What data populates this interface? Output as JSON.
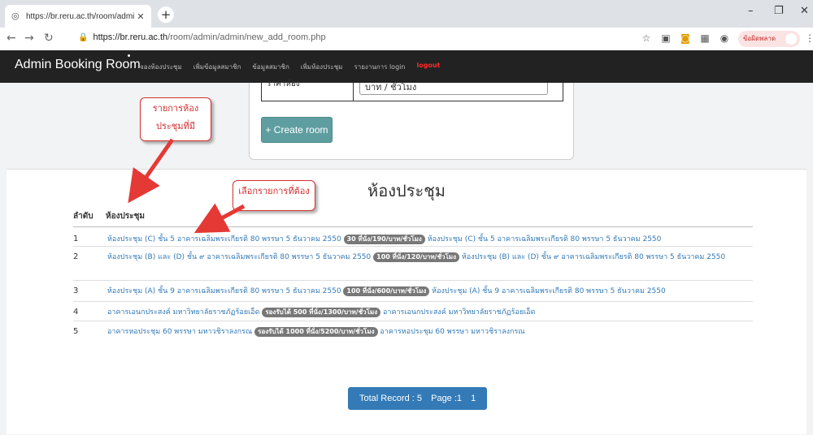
{
  "browser": {
    "tab_title": "https://br.reru.ac.th/room/admin",
    "url_host": "https://br.reru.ac.th",
    "url_path": "/room/admin/admin/new_add_room.php",
    "profile_label": "ข้อผิดพลาด"
  },
  "navbar": {
    "brand": "Admin Booking Room",
    "links": [
      "จองห้องประชุม",
      "เพิ่มข้อมูลสมาชิก",
      "ข้อมูลสมาชิก",
      "เพิ่มห้องประชุม",
      "รายงานการ login"
    ],
    "logout": "logout"
  },
  "form": {
    "rate_unit": "บาท / ชั่วโมง",
    "create_button": "+ Create room"
  },
  "list": {
    "title": "ห้องประชุม",
    "col_order": "ลำดับ",
    "col_room": "ห้องประชุม",
    "rows": [
      {
        "num": "1",
        "pre": "ห้องประชุม (C) ชั้น 5 อาคารเฉลิมพระเกียรติ 80 พรรษา 5 ธันวาคม 2550",
        "badge": "30 ที่นั่ง/190/บาท/ชั่วโมง",
        "post": "ห้องประชุม (C) ชั้น 5 อาคารเฉลิมพระเกียรติ 80 พรรษา 5 ธันวาคม 2550"
      },
      {
        "num": "2",
        "pre": "ห้องประชุม (B) และ (D) ชั้น ๙ อาคารเฉลิมพระเกียรติ 80 พรรษา 5 ธันวาคม 2550",
        "badge": "100 ที่นั่ง/120/บาท/ชั่วโมง",
        "post": "ห้องประชุม (B) และ (D) ชั้น ๙ อาคารเฉลิมพระเกียรติ 80 พรรษา 5 ธันวาคม 2550"
      },
      {
        "num": "3",
        "pre": "ห้องประชุม (A) ชั้น 9 อาคารเฉลิมพระเกียรติ 80 พรรษา 5 ธันวาคม 2550",
        "badge": "100 ที่นั่ง/600/บาท/ชั่วโมง",
        "post": "ห้องประชุม (A) ชั้น 9 อาคารเฉลิมพระเกียรติ 80 พรรษา 5 ธันวาคม 2550"
      },
      {
        "num": "4",
        "pre": "อาคารเอนกประสงค์ มหาวิทยาลัยราชภัฏร้อยเอ็ด",
        "badge": "รองรับได้ 500 ที่นั่ง/1300/บาท/ชั่วโมง",
        "post": "อาคารเอนกประสงค์ มหาวิทยาลัยราชภัฏร้อยเอ็ด"
      },
      {
        "num": "5",
        "pre": "อาคารหอประชุม 60 พรรษา มหาวชิราลงกรณ",
        "badge": "รองรับได้ 1000 ที่นั่ง/5200/บาท/ชั่วโมง",
        "post": "อาคารหอประชุม 60 พรรษา มหาวชิราลงกรณ"
      }
    ],
    "pager": {
      "total": "Total Record : 5",
      "page": "Page :1",
      "current": "1"
    }
  },
  "annotations": {
    "callout_rooms": "รายการห้องประชุมที่มี",
    "callout_select": "เลือกรายการที่ต้อง"
  },
  "colors": {
    "accent": "#337ab7",
    "create": "#5f9ea0",
    "annotation": "#d32f2f",
    "navbar": "#222222"
  }
}
